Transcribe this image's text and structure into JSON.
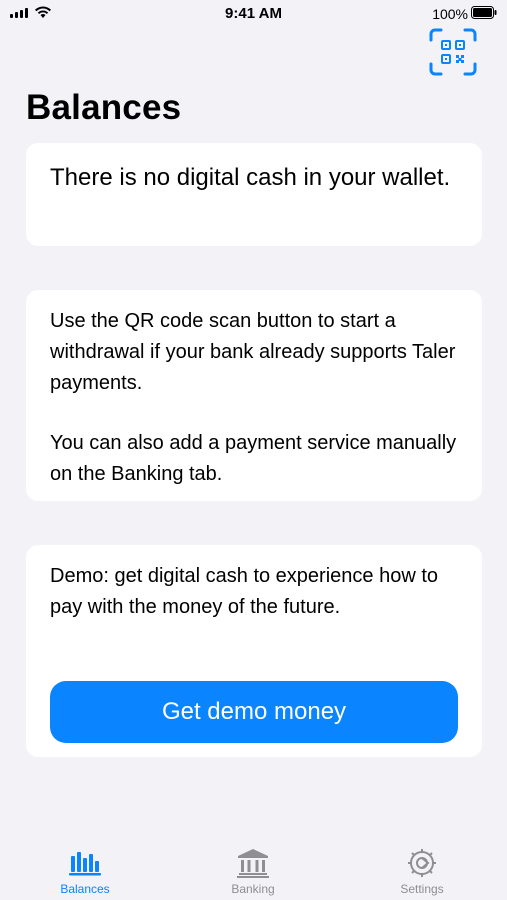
{
  "status_bar": {
    "time": "9:41 AM",
    "battery_percent": "100%",
    "battery_level": 1.0
  },
  "header": {
    "title": "Balances",
    "qr_button_icon": "qr-code-scan-icon"
  },
  "cards": {
    "empty_wallet": "There is no digital cash in your wallet.",
    "instructions_1": "Use the QR code scan button to start a withdrawal if your bank already supports Taler payments.",
    "instructions_2": "You can also add a payment service manually on the Banking tab.",
    "demo_text": "Demo: get digital cash to experience how to pay with the money of the future.",
    "demo_button": "Get demo money"
  },
  "tab_bar": {
    "tabs": [
      {
        "label": "Balances",
        "icon": "chart-bars-icon",
        "active": true
      },
      {
        "label": "Banking",
        "icon": "bank-icon",
        "active": false
      },
      {
        "label": "Settings",
        "icon": "settings-gear-icon",
        "active": false
      }
    ]
  },
  "colors": {
    "accent": "#0a84ff",
    "background": "#f2f2f7",
    "card": "#ffffff",
    "inactive_tab": "#8e8e93"
  }
}
